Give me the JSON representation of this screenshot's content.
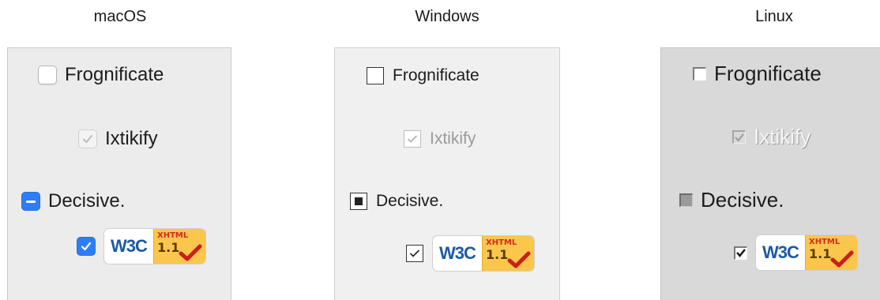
{
  "columns": {
    "mac": {
      "title": "macOS",
      "items": {
        "frognificate": "Frognificate",
        "ixtikify": "Ixtikify",
        "decisive": "Decisive."
      }
    },
    "windows": {
      "title": "Windows",
      "items": {
        "frognificate": "Frognificate",
        "ixtikify": "Ixtikify",
        "decisive": "Decisive."
      }
    },
    "linux": {
      "title": "Linux",
      "items": {
        "frognificate": "Frognificate",
        "ixtikify": "Ixtikify",
        "decisive": "Decisive."
      }
    }
  },
  "states": {
    "frognificate": "unchecked",
    "ixtikify": "checked-disabled",
    "decisive": "partially-checked",
    "badge_checkbox": "checked"
  },
  "badge": {
    "left_text": "W3C",
    "top_text": "XHTML",
    "version": "1.1"
  },
  "colors": {
    "mac_accent": "#2f7df6",
    "badge_yellow": "#fbc64c",
    "w3c_blue": "#1a5aa6",
    "check_red": "#c8201a"
  }
}
